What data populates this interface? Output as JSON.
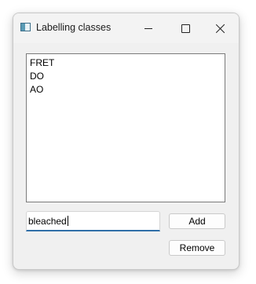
{
  "window": {
    "title": "Labelling classes",
    "controls": {
      "minimize": "minimize-icon",
      "maximize": "maximize-icon",
      "close": "close-icon"
    }
  },
  "classes_list": {
    "items": [
      "FRET",
      "DO",
      "AO"
    ]
  },
  "new_class_input": {
    "value": "bleached"
  },
  "buttons": {
    "add_label": "Add",
    "remove_label": "Remove"
  },
  "colors": {
    "accent_focus_underline": "#2f6fa8",
    "window_background": "#f0f0f0"
  }
}
